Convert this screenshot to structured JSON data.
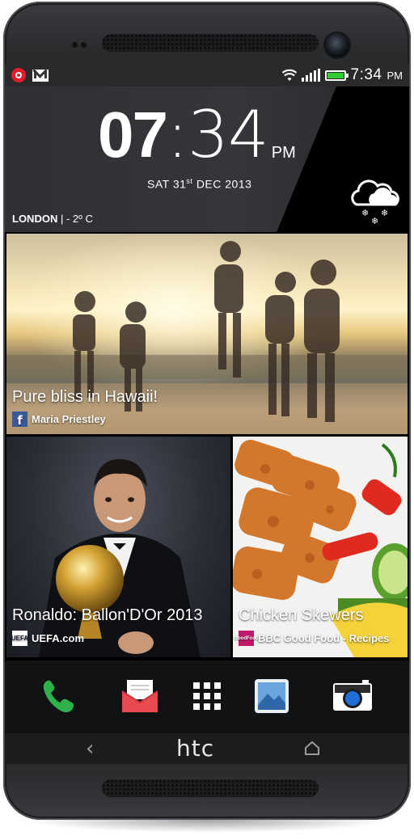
{
  "status_bar": {
    "time": "7:34",
    "ampm": "PM",
    "icons": [
      "beats-audio-icon",
      "gmail-icon",
      "wifi-icon",
      "signal-bars-icon",
      "battery-icon"
    ],
    "battery_color": "#33cc33"
  },
  "clock": {
    "hours": "07",
    "separator": ":",
    "minutes": "34",
    "ampm": "PM",
    "day": "SAT 31",
    "ordinal": "st",
    "month_year": "DEC 2013"
  },
  "weather": {
    "city": "LONDON",
    "separator": " | - 2º C",
    "icon": "snow-cloud-icon"
  },
  "tiles": [
    {
      "title": "Pure bliss in Hawaii!",
      "source": "Maria Priestley",
      "source_icon": "facebook-icon",
      "icon_text": "f"
    },
    {
      "title": "Ronaldo: Ballon'D'Or 2013",
      "source": "UEFA.com",
      "source_icon": "uefa-icon",
      "icon_text": "UEFA"
    },
    {
      "title": "Chicken Skewers",
      "source": "BBC Good Food - Recipes",
      "source_icon": "goodfood-icon",
      "icon_text": "GoodFood"
    }
  ],
  "dock": [
    {
      "name": "phone",
      "icon": "phone-icon",
      "color": "#2fb14b"
    },
    {
      "name": "mail",
      "icon": "mail-icon",
      "color": "#e84a4f"
    },
    {
      "name": "apps",
      "icon": "app-grid-icon",
      "color": "#ffffff"
    },
    {
      "name": "gallery",
      "icon": "gallery-icon",
      "color": "#4a90d9"
    },
    {
      "name": "camera",
      "icon": "camera-icon",
      "color": "#1e6fd6"
    }
  ],
  "nav_bar": {
    "back": "‹",
    "logo": "htc",
    "home_icon": "home-icon"
  }
}
